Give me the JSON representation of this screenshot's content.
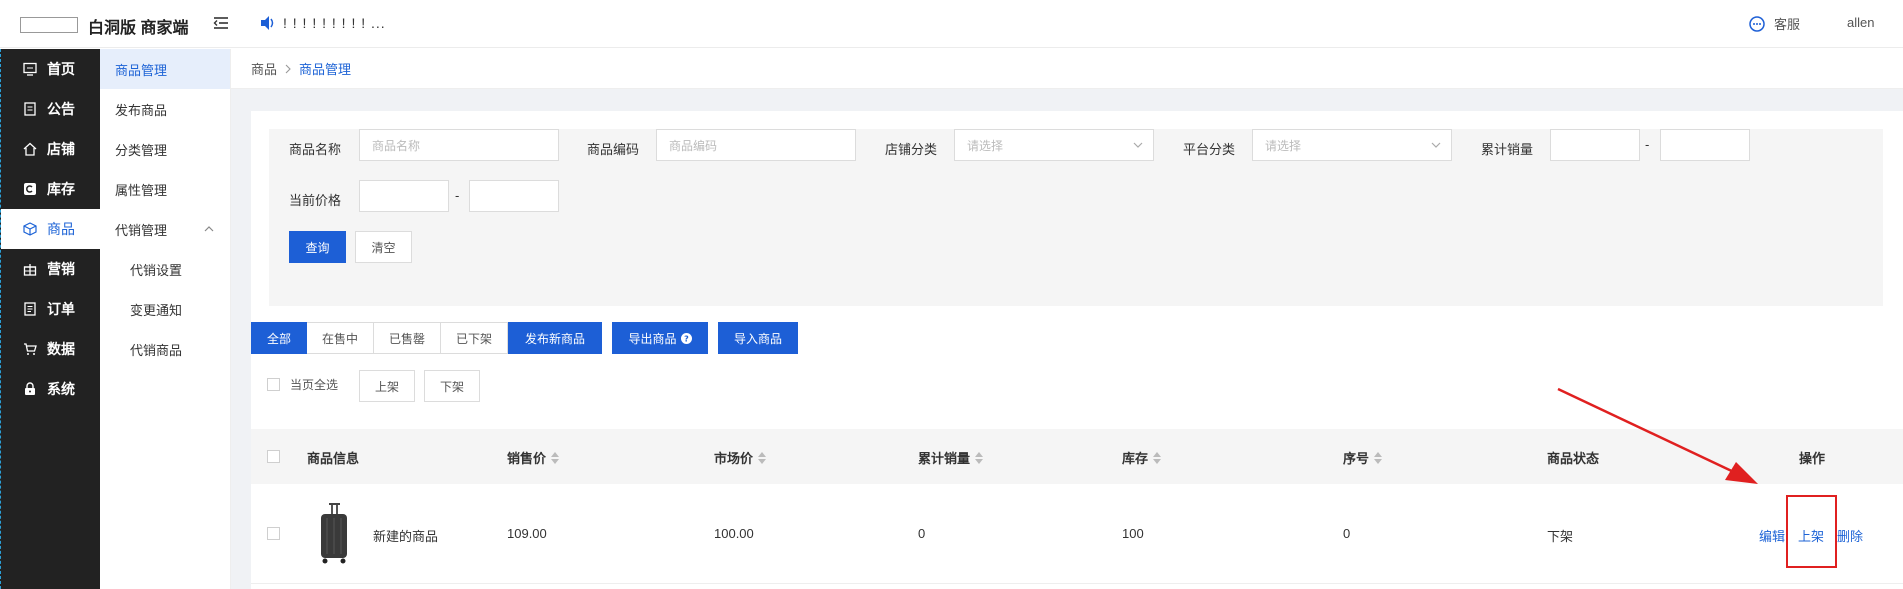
{
  "header": {
    "brand": "白洞版 商家端",
    "notice": "! ! ! ! ! ! ! ! ! ...",
    "service": "客服",
    "user": "allen"
  },
  "sidebar": {
    "items": [
      {
        "label": "首页",
        "icon": "monitor-icon"
      },
      {
        "label": "公告",
        "icon": "document-icon"
      },
      {
        "label": "店铺",
        "icon": "home-icon"
      },
      {
        "label": "库存",
        "icon": "copyright-icon"
      },
      {
        "label": "商品",
        "icon": "cube-icon"
      },
      {
        "label": "营销",
        "icon": "gift-icon"
      },
      {
        "label": "订单",
        "icon": "order-icon"
      },
      {
        "label": "数据",
        "icon": "cart-icon"
      },
      {
        "label": "系统",
        "icon": "lock-icon"
      }
    ]
  },
  "submenu": {
    "items": [
      "商品管理",
      "发布商品",
      "分类管理",
      "属性管理",
      "代销管理",
      "代销设置",
      "变更通知",
      "代销商品"
    ]
  },
  "breadcrumb": {
    "root": "商品",
    "current": "商品管理"
  },
  "filter": {
    "name_label": "商品名称",
    "name_placeholder": "商品名称",
    "code_label": "商品编码",
    "code_placeholder": "商品编码",
    "shop_cat_label": "店铺分类",
    "shop_cat_placeholder": "请选择",
    "platform_cat_label": "平台分类",
    "platform_cat_placeholder": "请选择",
    "sales_label": "累计销量",
    "price_label": "当前价格",
    "dash": "-",
    "query_btn": "查询",
    "clear_btn": "清空"
  },
  "tabs": [
    "全部",
    "在售中",
    "已售罄",
    "已下架"
  ],
  "actions": {
    "publish": "发布新商品",
    "export": "导出商品",
    "import": "导入商品"
  },
  "bulk": {
    "select_all": "当页全选",
    "on_shelf": "上架",
    "off_shelf": "下架"
  },
  "table": {
    "headers": [
      "商品信息",
      "销售价",
      "市场价",
      "累计销量",
      "库存",
      "序号",
      "商品状态",
      "操作"
    ],
    "rows": [
      {
        "name": "新建的商品",
        "sale_price": "109.00",
        "market_price": "100.00",
        "sales": "0",
        "stock": "100",
        "order": "0",
        "status": "下架",
        "ops": [
          "编辑",
          "上架",
          "删除"
        ]
      }
    ]
  },
  "colors": {
    "primary": "#1d5fd6",
    "sidebar_bg": "#222222",
    "annotation": "#e02020"
  }
}
